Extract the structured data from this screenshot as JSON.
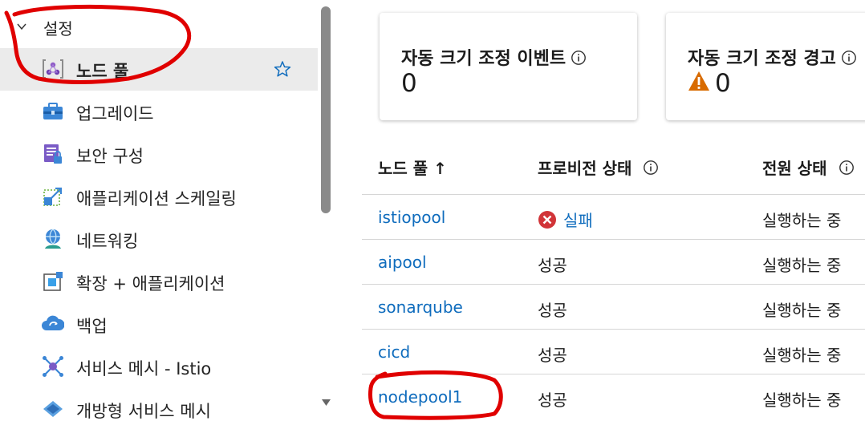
{
  "sidebar": {
    "group_label": "설정",
    "items": [
      {
        "label": "노드 풀",
        "icon": "node-pool-icon",
        "active": true
      },
      {
        "label": "업그레이드",
        "icon": "upgrade-icon"
      },
      {
        "label": "보안 구성",
        "icon": "security-config-icon"
      },
      {
        "label": "애플리케이션 스케일링",
        "icon": "app-scaling-icon"
      },
      {
        "label": "네트워킹",
        "icon": "networking-icon"
      },
      {
        "label": "확장 + 애플리케이션",
        "icon": "extensions-icon"
      },
      {
        "label": "백업",
        "icon": "backup-icon"
      },
      {
        "label": "서비스 메시 - Istio",
        "icon": "service-mesh-icon"
      },
      {
        "label": "개방형 서비스 메시",
        "icon": "open-service-mesh-icon"
      }
    ]
  },
  "cards": [
    {
      "title": "자동 크기 조정 이벤트",
      "value": "0"
    },
    {
      "title": "자동 크기 조정 경고",
      "value": "0"
    }
  ],
  "table": {
    "headers": {
      "name": "노드 풀 ↑",
      "provisioning": "프로비전 상태",
      "power": "전원 상태"
    },
    "rows": [
      {
        "name": "istiopool",
        "provisioning": "실패",
        "power": "실행하는 중"
      },
      {
        "name": "aipool",
        "provisioning": "성공",
        "power": "실행하는 중"
      },
      {
        "name": "sonarqube",
        "provisioning": "성공",
        "power": "실행하는 중"
      },
      {
        "name": "cicd",
        "provisioning": "성공",
        "power": "실행하는 중"
      },
      {
        "name": "nodepool1",
        "provisioning": "성공",
        "power": "실행하는 중"
      }
    ]
  },
  "colors": {
    "link": "#0f6cbd",
    "error": "#d13438",
    "warning": "#d86b00",
    "annotation": "#e00000"
  }
}
